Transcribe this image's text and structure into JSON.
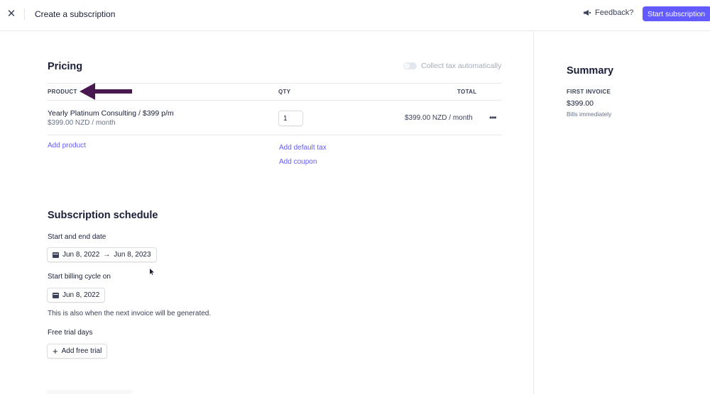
{
  "topbar": {
    "close_glyph": "✕",
    "title": "Create a subscription",
    "feedback_label": "Feedback?",
    "start_button": "Start subscription"
  },
  "pricing": {
    "title": "Pricing",
    "tax_toggle_label": "Collect tax automatically",
    "tax_toggle_on": false,
    "columns": {
      "product": "PRODUCT",
      "qty": "QTY",
      "total": "TOTAL"
    },
    "items": [
      {
        "name": "Yearly Platinum Consulting / $399 p/m",
        "price": "$399.00 NZD / month",
        "qty": "1",
        "total": "$399.00 NZD / month"
      }
    ],
    "more_glyph": "•••",
    "add_product": "Add product",
    "add_default_tax": "Add default tax",
    "add_coupon": "Add coupon"
  },
  "schedule": {
    "title": "Subscription schedule",
    "date_label": "Start and end date",
    "start_date": "Jun 8, 2022",
    "arrow_glyph": "→",
    "end_date": "Jun 8, 2023",
    "billing_label": "Start billing cycle on",
    "billing_date": "Jun 8, 2022",
    "helper": "This is also when the next invoice will be generated.",
    "trial_label": "Free trial days",
    "add_trial_glyph": "+",
    "add_trial": "Add free trial"
  },
  "summary": {
    "title": "Summary",
    "invoice_label": "FIRST INVOICE",
    "amount": "$399.00",
    "note": "Bills immediately"
  },
  "colors": {
    "accent": "#635bff",
    "annotation_arrow": "#4a1850",
    "border": "#e3e8ee"
  }
}
